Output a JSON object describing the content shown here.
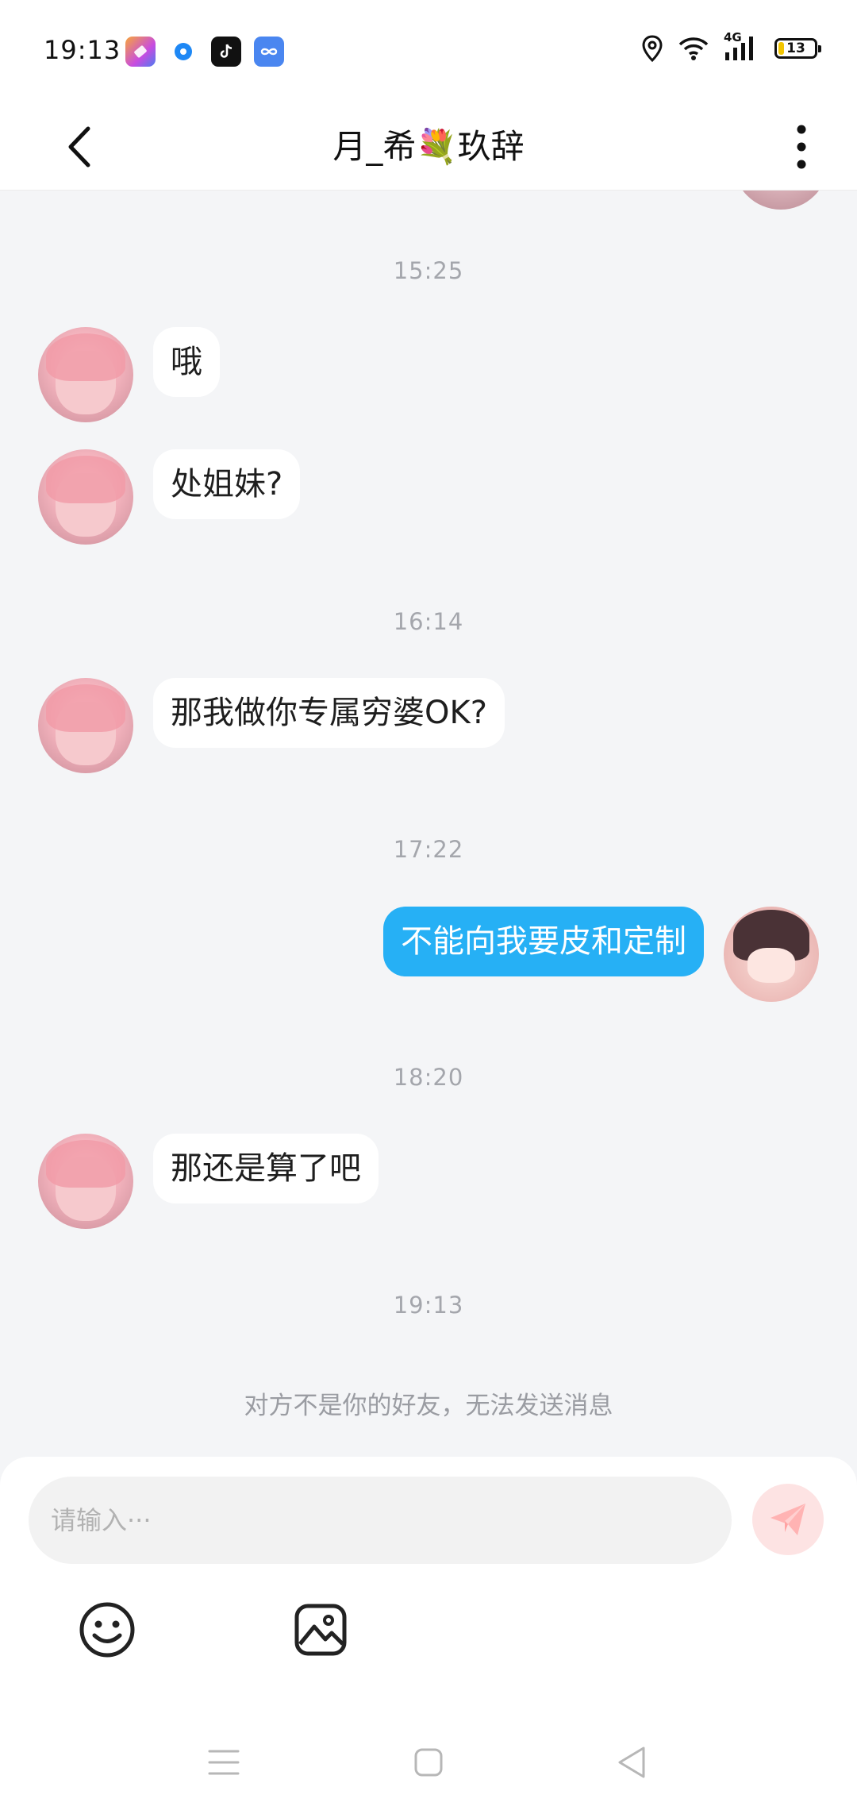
{
  "status_bar": {
    "time": "19:13",
    "network_type": "4G",
    "battery_level": "13",
    "app_icons": [
      "toolbox-app-icon",
      "blue-dot-app-icon",
      "tiktok-icon",
      "cloud-app-icon"
    ]
  },
  "header": {
    "title": "月_希💐玖辞",
    "back_icon": "chevron-left-icon",
    "more_icon": "more-vertical-icon"
  },
  "messages": [
    {
      "type": "timestamp",
      "text": "15:25"
    },
    {
      "type": "incoming",
      "text": "哦"
    },
    {
      "type": "incoming",
      "text": "处姐妹?"
    },
    {
      "type": "timestamp",
      "text": "16:14"
    },
    {
      "type": "incoming",
      "text": "那我做你专属穷婆OK?"
    },
    {
      "type": "timestamp",
      "text": "17:22"
    },
    {
      "type": "outgoing",
      "text": "不能向我要皮和定制"
    },
    {
      "type": "timestamp",
      "text": "18:20"
    },
    {
      "type": "incoming",
      "text": "那还是算了吧"
    },
    {
      "type": "timestamp",
      "text": "19:13"
    }
  ],
  "notice": "对方不是你的好友，无法发送消息",
  "composer": {
    "placeholder": "请输入···",
    "value": "",
    "send_icon": "send-icon",
    "emoji_icon": "smiley-icon",
    "image_icon": "image-icon"
  },
  "colors": {
    "outgoing_bubble": "#26b0f5",
    "incoming_bubble": "#ffffff",
    "chat_background": "#f4f5f7",
    "send_button": "#fde3e3",
    "send_icon": "#ffb3b3"
  }
}
